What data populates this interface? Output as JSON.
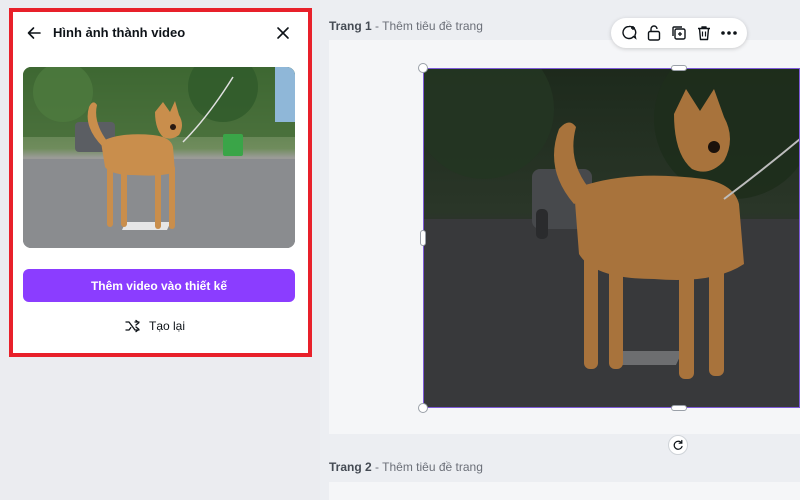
{
  "panel": {
    "title": "Hình ảnh thành video",
    "back_icon": "arrow-left-icon",
    "close_icon": "close-icon",
    "primary_button": "Thêm video vào thiết kế",
    "regenerate_button": "Tạo lại",
    "regenerate_icon": "shuffle-icon",
    "highlight_color": "#e8202a",
    "button_color": "#8b3dff"
  },
  "editor": {
    "page1": {
      "number": "Trang 1",
      "title_placeholder": "Thêm tiêu đề trang"
    },
    "page2": {
      "number": "Trang 2",
      "title_placeholder": "Thêm tiêu đề trang"
    },
    "separator": " - ",
    "toolbar_icons": [
      "comment-plus-icon",
      "lock-icon",
      "duplicate-icon",
      "trash-icon",
      "more-icon"
    ],
    "selection_color": "#7d5ad8"
  }
}
